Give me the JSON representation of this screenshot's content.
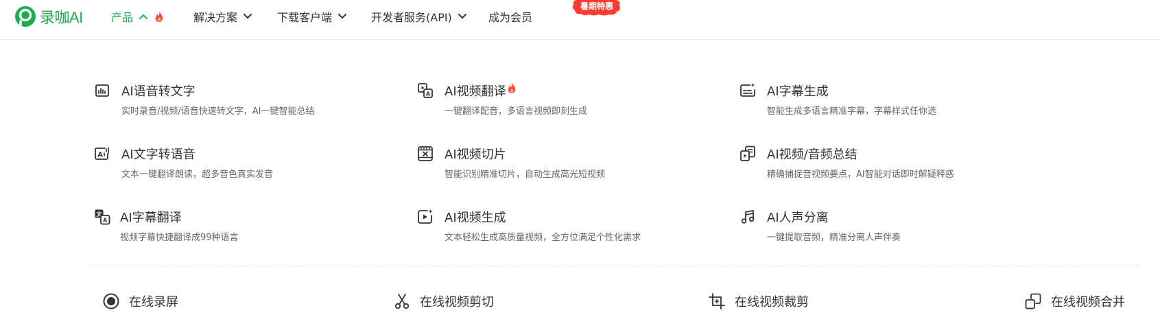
{
  "header": {
    "logo_text": "录咖AI",
    "nav": [
      {
        "label": "产品",
        "state": "expanded"
      },
      {
        "label": "解决方案"
      },
      {
        "label": "下载客户端"
      },
      {
        "label": "开发者服务(API)"
      },
      {
        "label": "成为会员"
      }
    ],
    "promo_badge": "暑期特惠"
  },
  "features": [
    {
      "title": "AI语音转文字",
      "desc": "实时录音/视频/语音快速转文字，AI一键智能总结",
      "icon": "waveform-text-icon"
    },
    {
      "title": "AI视频翻译",
      "desc": "一键翻译配音，多语言视频即刻生成",
      "icon": "video-translate-icon",
      "hot": true
    },
    {
      "title": "AI字幕生成",
      "desc": "智能生成多语言精准字幕，字幕样式任你选",
      "icon": "subtitle-sparkle-icon"
    },
    {
      "title": "AI文字转语音",
      "desc": "文本一键翻译朗读，超多音色真实发音",
      "icon": "text-to-speech-icon"
    },
    {
      "title": "AI视频切片",
      "desc": "智能识别精准切片，自动生成高光短视频",
      "icon": "video-cut-icon"
    },
    {
      "title": "AI视频/音频总结",
      "desc": "精确捕捉音视频要点，AI智能对话即时解疑释惑",
      "icon": "summary-doc-icon"
    },
    {
      "title": "AI字幕翻译",
      "desc": "视频字幕快捷翻译成99种语言",
      "icon": "subtitle-translate-icon"
    },
    {
      "title": "AI视频生成",
      "desc": "文本轻松生成高质量视频，全方位满足个性化需求",
      "icon": "video-generate-icon"
    },
    {
      "title": "AI人声分离",
      "desc": "一键提取音频，精准分离人声伴奏",
      "icon": "music-note-icon"
    }
  ],
  "tools": [
    {
      "label": "在线录屏",
      "icon": "record-icon"
    },
    {
      "label": "在线视频剪切",
      "icon": "scissors-icon"
    },
    {
      "label": "在线视频裁剪",
      "icon": "crop-icon"
    },
    {
      "label": "在线视频合并",
      "icon": "merge-icon"
    }
  ],
  "colors": {
    "brand": "#1aad4b",
    "hot": "#ff4d2e",
    "text": "#333333",
    "muted": "#666666"
  }
}
